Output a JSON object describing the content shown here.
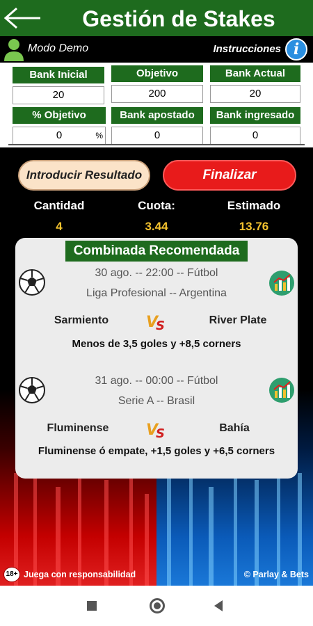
{
  "header": {
    "title": "Gestión de Stakes",
    "back_icon": "arrow-left-icon"
  },
  "demo_bar": {
    "mode_label": "Modo Demo",
    "instructions_label": "Instrucciones",
    "info_symbol": "i"
  },
  "stats": {
    "bank_inicial": {
      "label": "Bank Inicial",
      "value": "20"
    },
    "objetivo": {
      "label": "Objetivo",
      "value": "200"
    },
    "bank_actual": {
      "label": "Bank Actual",
      "value": "20"
    },
    "pct_objetivo": {
      "label": "% Objetivo",
      "value": "0",
      "unit": "%"
    },
    "bank_apostado": {
      "label": "Bank apostado",
      "value": "0"
    },
    "bank_ingresado": {
      "label": "Bank ingresado",
      "value": "0"
    }
  },
  "actions": {
    "introducir": "Introducir Resultado",
    "finalizar": "Finalizar"
  },
  "summary": {
    "cantidad": {
      "label": "Cantidad",
      "value": "4"
    },
    "cuota": {
      "label": "Cuota:",
      "value": "3.44"
    },
    "estimado": {
      "label": "Estimado",
      "value": "13.76"
    }
  },
  "card": {
    "title": "Combinada Recomendada",
    "matches": [
      {
        "datetime": "30 ago. -- 22:00 -- Fútbol",
        "league": "Liga Profesional -- Argentina",
        "home": "Sarmiento",
        "away": "River Plate",
        "pick": "Menos de 3,5 goles y +8,5 corners"
      },
      {
        "datetime": "31 ago. -- 00:00 -- Fútbol",
        "league": "Serie  A -- Brasil",
        "home": "Fluminense",
        "away": "Bahía",
        "pick": "Fluminense ó empate, +1,5 goles y +6,5 corners"
      }
    ]
  },
  "footer": {
    "age_badge": "18+",
    "left": "Juega con responsabilidad",
    "right": "© Parlay & Bets"
  },
  "colors": {
    "header_green": "#1e6b1e",
    "finalizar_red": "#e81b1b",
    "summary_yellow": "#f2c12e"
  }
}
